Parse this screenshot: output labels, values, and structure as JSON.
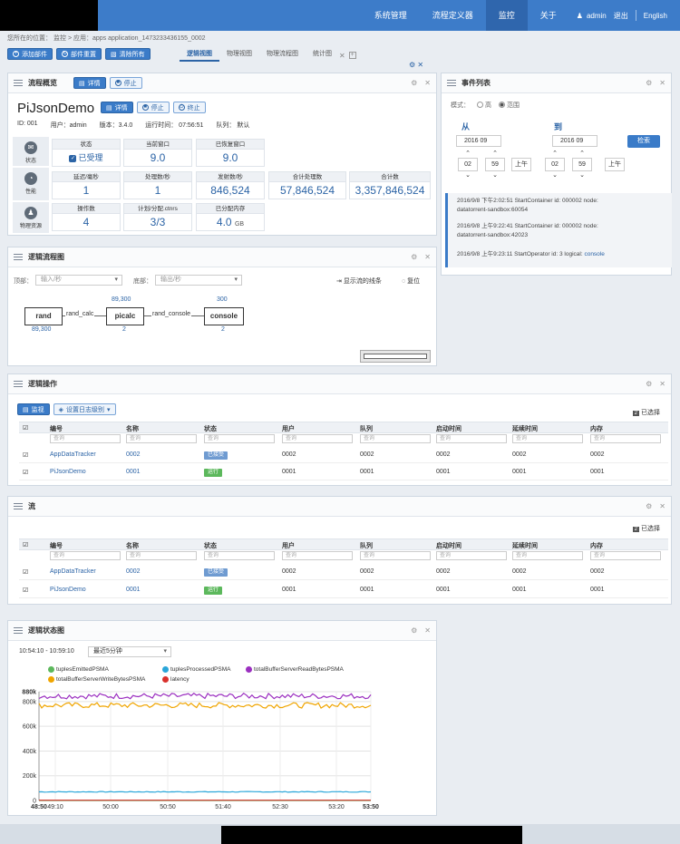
{
  "nav": {
    "items": [
      "系统管理",
      "流程定义器",
      "监控",
      "关于"
    ],
    "active_index": 2,
    "user": "admin",
    "logout": "退出",
    "language": "English"
  },
  "breadcrumb": {
    "location_label": "您所在的位置：",
    "path": "监控 > 应用：apps  application_1473233436155_0002"
  },
  "toolbar": {
    "add_widget": "添加部件",
    "reset_widgets": "部件重置",
    "clear_all": "清除所有"
  },
  "tabs": [
    "逻辑视图",
    "物理视图",
    "物理流程图",
    "统计图"
  ],
  "overview": {
    "title": "流程概览",
    "detail_btn": "详情",
    "stop_btn": "停止",
    "end_btn": "终止",
    "app_name": "PiJsonDemo",
    "id": "ID:  001",
    "user": "用户：admin",
    "version": "版本：3.4.0",
    "uptime": "运行时间： 07:56:51",
    "queue": "队列： 默认",
    "side": [
      "状态",
      "性能",
      "物理资源"
    ],
    "metrics": {
      "state_label": "状态",
      "state_value": "已受理",
      "current_window_label": "当前窗口",
      "current_window_value": "9.0",
      "recovered_window_label": "已恢复窗口",
      "recovered_window_value": "9.0",
      "latency_label": "延迟/毫秒",
      "latency_value": "1",
      "processed_label": "处理数/秒",
      "processed_value": "1",
      "emitted_label": "发射数/秒",
      "emitted_value": "846,524",
      "total_processed_label": "合计处理数",
      "total_processed_value": "57,846,524",
      "total_emitted_label": "合计数",
      "total_emitted_value": "3,357,846,524",
      "operators_label": "操作数",
      "operators_value": "4",
      "containers_label": "计划/分配.ctnrs",
      "containers_value": "3/3",
      "memory_label": "已分配内存",
      "memory_value": "4.0",
      "memory_unit": "GB"
    }
  },
  "events": {
    "title": "事件列表",
    "mode_label": "模式：",
    "mode_high": "高",
    "mode_range": "范围",
    "from_label": "从",
    "to_label": "到",
    "from_date": "2016 09",
    "to_date": "2016 09",
    "from_hour": "02",
    "from_min": "59",
    "from_ampm": "上午",
    "to_hour": "02",
    "to_min": "59",
    "to_ampm": "上午",
    "search_btn": "检索",
    "items": [
      {
        "line1": "2016/9/8 下午2:02:51 StartContainer id: 000002 node:",
        "line2": "datatorrent-sandbox:60054",
        "link": ""
      },
      {
        "line1": "2016/9/8 上午9:22:41 StartContainer id: 000002 node:",
        "line2": "datatorrent-sandbox:42023",
        "link": ""
      },
      {
        "line1": "2016/9/8 上午9:23:11 StartOperator id: 3 logical:",
        "line2": "",
        "link": "console"
      }
    ]
  },
  "dag": {
    "title": "逻辑流程图",
    "top_label": "顶部：",
    "top_placeholder": "输入/秒",
    "bottom_label": "底部：",
    "bottom_placeholder": "输出/秒",
    "show_streams": "显示流的线条",
    "reset": "复位",
    "nodes": [
      {
        "name": "rand",
        "top": "",
        "bottom": "89,300"
      },
      {
        "name": "picalc",
        "top": "89,300",
        "bottom": "2"
      },
      {
        "name": "console",
        "top": "300",
        "bottom": "2"
      }
    ],
    "edges": [
      "rand_calc",
      "rand_console"
    ]
  },
  "operators": {
    "title": "逻辑操作",
    "monitor_btn": "监视",
    "log_level_btn": "设置日志级别",
    "selected": "已选择",
    "selected_count": "2",
    "columns": [
      "编号",
      "名称",
      "状态",
      "用户",
      "队列",
      "启动时间",
      "延续时间",
      "内存"
    ],
    "filter_placeholder": "查询",
    "rows": [
      {
        "id": "AppDataTracker",
        "name": "0002",
        "state": "已接受",
        "user": "0002",
        "queue": "0002",
        "start": "0002",
        "duration": "0002",
        "memory": "0002"
      },
      {
        "id": "PiJsonDemo",
        "name": "0001",
        "state": "运行",
        "user": "0001",
        "queue": "0001",
        "start": "0001",
        "duration": "0001",
        "memory": "0001"
      }
    ]
  },
  "streams": {
    "title": "流",
    "selected": "已选择",
    "selected_count": "2",
    "columns": [
      "编号",
      "名称",
      "状态",
      "用户",
      "队列",
      "启动时间",
      "延续时间",
      "内存"
    ],
    "filter_placeholder": "查询",
    "rows": [
      {
        "id": "AppDataTracker",
        "name": "0002",
        "state": "已接受",
        "user": "0002",
        "queue": "0002",
        "start": "0002",
        "duration": "0002",
        "memory": "0002"
      },
      {
        "id": "PiJsonDemo",
        "name": "0001",
        "state": "运行",
        "user": "0001",
        "queue": "0001",
        "start": "0001",
        "duration": "0001",
        "memory": "0001"
      }
    ]
  },
  "chart_widget": {
    "title": "逻辑状态图",
    "time_range": "10:54:10 - 10:59:10",
    "range_select": "最近5分钟"
  },
  "chart_data": {
    "type": "line",
    "title": "",
    "xlabel": "",
    "ylabel": "",
    "x_ticks": [
      "48:50",
      "49:10",
      "50:00",
      "50:50",
      "51:40",
      "52:30",
      "53:20",
      "53:50"
    ],
    "y_ticks": [
      "0",
      "200k",
      "400k",
      "600k",
      "800k",
      "880k"
    ],
    "ylim": [
      0,
      880000
    ],
    "grid": true,
    "legend_position": "top",
    "series": [
      {
        "name": "tuplesEmittedPSMA",
        "color": "#5cb85c",
        "level": 0
      },
      {
        "name": "tuplesProcessedPSMA",
        "color": "#2aa6d9",
        "level": 70000
      },
      {
        "name": "totalBufferServerReadBytesPSMA",
        "color": "#9b2fc0",
        "level": 845000
      },
      {
        "name": "totalBufferServerWriteBytesPSMA",
        "color": "#f0a500",
        "level": 770000
      },
      {
        "name": "latency",
        "color": "#d9302c",
        "level": 2000
      }
    ]
  },
  "colors": {
    "primary": "#3d7cc9",
    "accent": "#2c64a6"
  }
}
